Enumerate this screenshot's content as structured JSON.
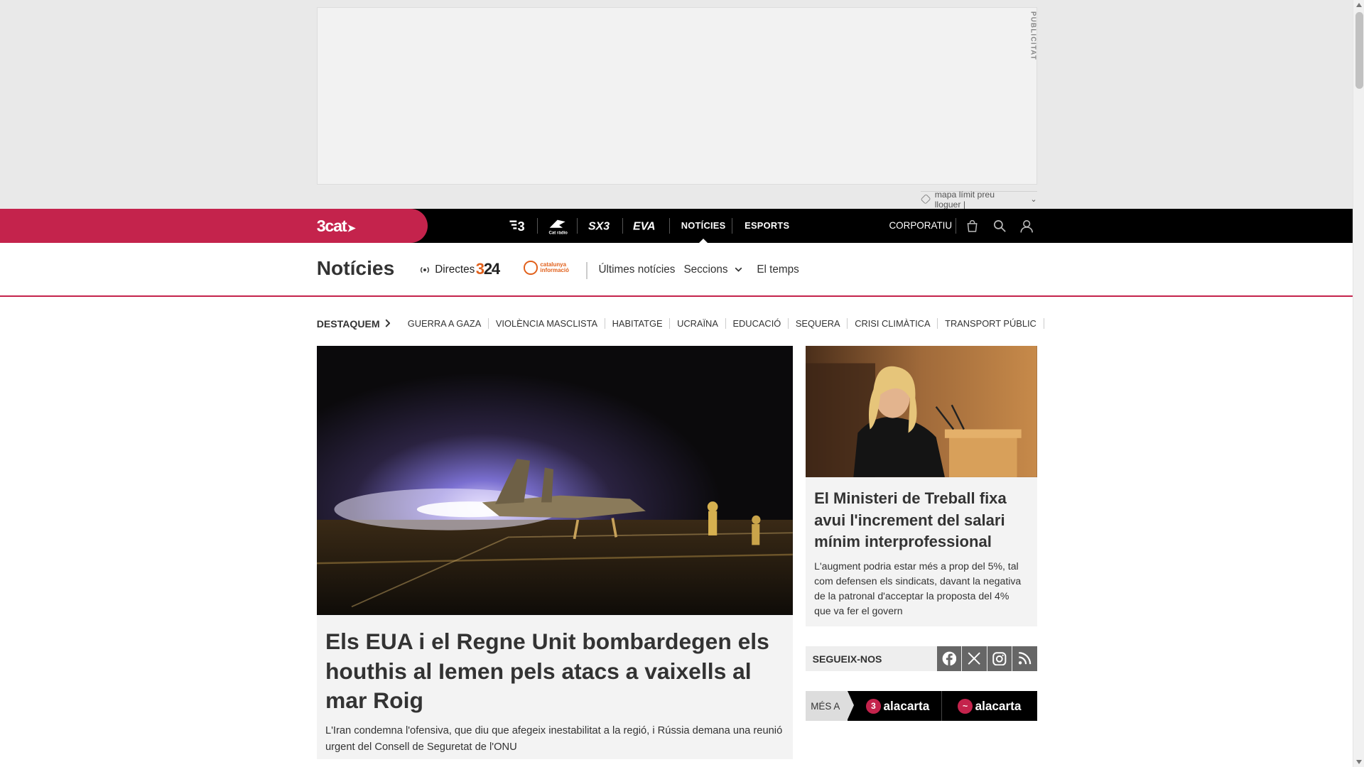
{
  "ad": {
    "label": "PUBLICITAT",
    "strip_text": "mapa límit preu lloguer |"
  },
  "topbar": {
    "brand": "3cat",
    "channels": [
      {
        "name": "tv3-logo",
        "label": "3"
      },
      {
        "name": "catradio-logo",
        "label": "Cat ràdio"
      },
      {
        "name": "sx3-logo",
        "label": "SX3"
      },
      {
        "name": "eva-logo",
        "label": "EVA"
      }
    ],
    "nav": [
      {
        "label": "NOTÍCIES",
        "active": true
      },
      {
        "label": "ESPORTS",
        "active": false
      }
    ],
    "corporatiu": "CORPORATIU",
    "accent_color": "#c4234c"
  },
  "section_header": {
    "title": "Notícies",
    "directes": "Directes",
    "logo_324": "24",
    "logo_324_prefix": "3",
    "logo_catinfo": "catalunya informació",
    "links": [
      "Últimes notícies",
      "Seccions",
      "El temps"
    ]
  },
  "destaquem": {
    "label": "DESTAQUEM",
    "items": [
      "GUERRA A GAZA",
      "VIOLÈNCIA MASCLISTA",
      "HABITATGE",
      "UCRAÏNA",
      "EDUCACIÓ",
      "SEQUERA",
      "CRISI CLIMÀTICA",
      "TRANSPORT PÚBLIC"
    ]
  },
  "main_article": {
    "title": "Els EUA i el Regne Unit bombardegen els houthis al Iemen pels atacs a vaixells al mar Roig",
    "subtitle": "L'Iran condemna l'ofensiva, que diu que afegeix inestabilitat a la regió, i Rússia demana una reunió urgent del Consell de Seguretat de l'ONU"
  },
  "side_article": {
    "title": "El Ministeri de Treball fixa avui l'increment del salari mínim interprofessional",
    "subtitle": "L'augment podria estar més a prop del 5%, tal com defensen els sindicats, davant la negativa de la patronal d'acceptar la proposta del 4% que va fer el govern"
  },
  "follow": {
    "label": "SEGUEIX-NOS",
    "icons": [
      "facebook-icon",
      "x-icon",
      "instagram-icon",
      "rss-icon"
    ]
  },
  "mesa": {
    "label": "MÉS A",
    "items": [
      {
        "badge": "3",
        "text": "alacarta"
      },
      {
        "badge": "~",
        "text": "alacarta"
      }
    ]
  }
}
